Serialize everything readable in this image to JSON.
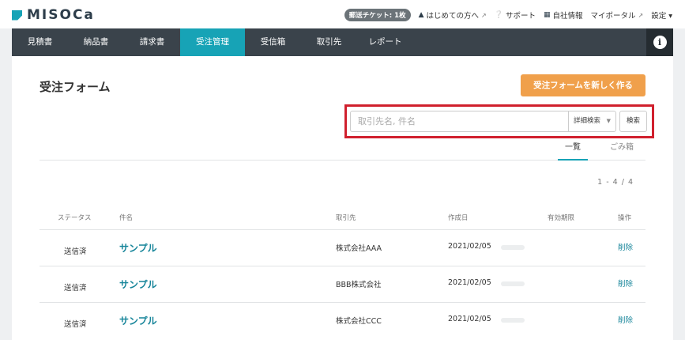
{
  "brand": {
    "logo_text": "MISOCa",
    "accent": "#17a3b6"
  },
  "toplinks": {
    "ticket": "郵送チケット: 1枚",
    "items": [
      {
        "icon": "book-icon",
        "label": "はじめての方へ",
        "external": true
      },
      {
        "icon": "question-icon",
        "label": "サポート",
        "external": false
      },
      {
        "icon": "building-icon",
        "label": "自社情報",
        "external": false
      },
      {
        "icon": "",
        "label": "マイポータル",
        "external": true
      },
      {
        "icon": "",
        "label": "設定 ▾",
        "external": false
      }
    ]
  },
  "nav": {
    "items": [
      "見積書",
      "納品書",
      "請求書",
      "受注管理",
      "受信箱",
      "取引先",
      "レポート"
    ],
    "active_index": 3,
    "info_label": "i"
  },
  "page": {
    "title": "受注フォーム",
    "new_button": "受注フォームを新しく作る",
    "search": {
      "placeholder": "取引先名, 件名",
      "detail_label": "詳細検索",
      "button": "検索"
    },
    "tabs": [
      "一覧",
      "ごみ箱"
    ],
    "pager": "1 - 4 / 4"
  },
  "table": {
    "headers": [
      "ステータス",
      "件名",
      "取引先",
      "作成日",
      "有効期限",
      "操作"
    ],
    "rows": [
      {
        "status": "送信済",
        "name": "サンプル",
        "client": "株式会社AAA",
        "date": "2021/02/05",
        "action": "削除"
      },
      {
        "status": "送信済",
        "name": "サンプル",
        "client": "BBB株式会社",
        "date": "2021/02/05",
        "action": "削除"
      },
      {
        "status": "送信済",
        "name": "サンプル",
        "client": "株式会社CCC",
        "date": "2021/02/05",
        "action": "削除"
      }
    ]
  }
}
